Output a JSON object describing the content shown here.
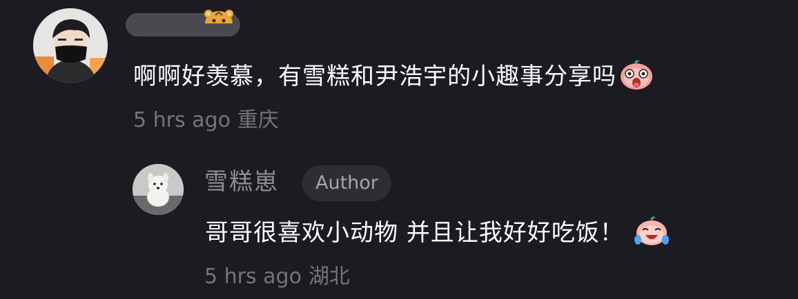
{
  "comments": [
    {
      "text": "啊啊好羡慕，有雪糕和尹浩宇的小趣事分享吗",
      "meta_time": "5 hrs ago",
      "meta_location": "重庆"
    }
  ],
  "reply": {
    "author_name": "雪糕崽",
    "badge_label": "Author",
    "text": "哥哥很喜欢小动物  并且让我好好吃饭！",
    "meta_time": "5 hrs ago",
    "meta_location": "湖北"
  },
  "colors": {
    "background": "#1c1b21",
    "primary_text": "#ffffff",
    "meta_text": "#75747b",
    "badge_bg": "#2e2d33"
  },
  "icons": [
    "tiger-head-sticker-icon",
    "shocked-face-emoji-icon",
    "laughing-crying-face-emoji-icon"
  ]
}
